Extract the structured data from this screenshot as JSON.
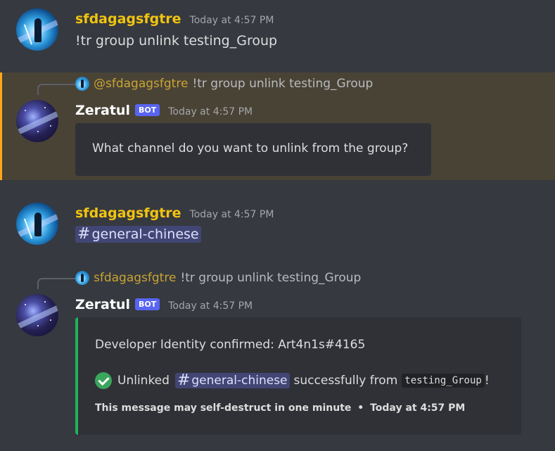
{
  "messages": [
    {
      "author": "sfdagagsfgtre",
      "timestamp": "Today at 4:57 PM",
      "content": "!tr group unlink testing_Group"
    },
    {
      "reply_to": {
        "mention": "@sfdagagsfgtre",
        "text": "!tr group unlink testing_Group"
      },
      "author": "Zeratul",
      "bot_tag": "BOT",
      "timestamp": "Today at 4:57 PM",
      "embed_text": "What channel do you want to unlink from the group?"
    },
    {
      "author": "sfdagagsfgtre",
      "timestamp": "Today at 4:57 PM",
      "channel_mention": {
        "hash": "#",
        "name": "general-chinese"
      }
    },
    {
      "reply_to": {
        "author": "sfdagagsfgtre",
        "text": "!tr group unlink testing_Group"
      },
      "author": "Zeratul",
      "bot_tag": "BOT",
      "timestamp": "Today at 4:57 PM",
      "embed": {
        "line1": "Developer Identity confirmed: Art4n1s#4165",
        "unlinked_prefix": "Unlinked",
        "channel_hash": "#",
        "channel_name": "general-chinese",
        "mid_text": "successfully from",
        "code": "testing_Group",
        "suffix": "!",
        "footer_text": "This message may self-destruct in one minute",
        "footer_sep": "•",
        "footer_time": "Today at 4:57 PM"
      }
    }
  ],
  "colors": {
    "background": "#36393f",
    "username": "#f1c40f",
    "bot_tag": "#5865f2",
    "highlight_bg": "#494336",
    "highlight_bar": "#faa81a",
    "embed_bg": "#2f3136",
    "embed_success_bar": "#20b35b"
  },
  "icons": {
    "success": "check-circle-icon"
  }
}
